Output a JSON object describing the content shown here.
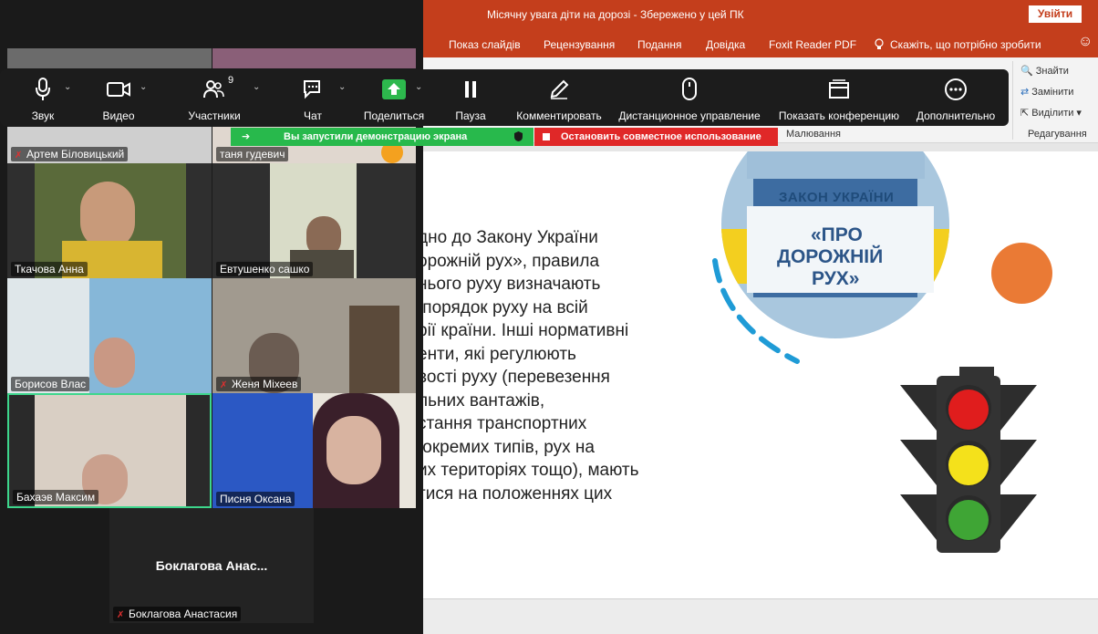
{
  "ppt": {
    "title": "Місячну увага діти на дорозі  -  Збережено у цей ПК",
    "signin": "Увійти",
    "menu": [
      "Показ слайдів",
      "Рецензування",
      "Подання",
      "Довідка",
      "Foxit Reader PDF",
      "Скажіть, що потрібно зробити"
    ],
    "ribbon": {
      "find": "Знайти",
      "replace": "Замінити",
      "select": "Виділити",
      "group_draw": "Малювання",
      "group_edit": "Редагування"
    },
    "slide_text": "дно до Закону України\nорожній рух», правила\nнього руху визначають\n порядок руху на всій\nрії країни. Інші нормативні\nенти, які регулюють\nвості руху (перевезення\nльних вантажів,\nстання транспортних\n окремих типів, рух на\nих територіях тощо), мають\nтися на положеннях цих\n.",
    "badge": {
      "line1": "ЗАКОН УКРАЇНИ",
      "line2": "«ПРО",
      "line3": "ДОРОЖНІЙ",
      "line4": "РУХ»"
    }
  },
  "zoom": {
    "toolbar": {
      "sound": "Звук",
      "video": "Видео",
      "participants": "Участники",
      "participants_count": "9",
      "chat": "Чат",
      "share": "Поделиться",
      "pause": "Пауза",
      "annotate": "Комментировать",
      "remote": "Дистанционное управление",
      "show_conf": "Показать конференцию",
      "more": "Дополнительно"
    },
    "banner_green": "Вы запустили демонстрацию экрана",
    "banner_red": "Остановить совместное использование",
    "participants": [
      {
        "name": "Артем Біловицький",
        "muted": true
      },
      {
        "name": "таня гудевич",
        "muted": false
      },
      {
        "name": "Ткачова Анна",
        "muted": false
      },
      {
        "name": "Евтушенко сашко",
        "muted": false
      },
      {
        "name": "Борисов Влас",
        "muted": false
      },
      {
        "name": "Женя Міхеев",
        "muted": true
      },
      {
        "name": "Бахаэв Максим",
        "muted": false
      },
      {
        "name": "Писня Оксана",
        "muted": false
      },
      {
        "name": "Боклагова Анастасия",
        "muted": true
      }
    ],
    "big_name": "Боклагова  Анас..."
  }
}
